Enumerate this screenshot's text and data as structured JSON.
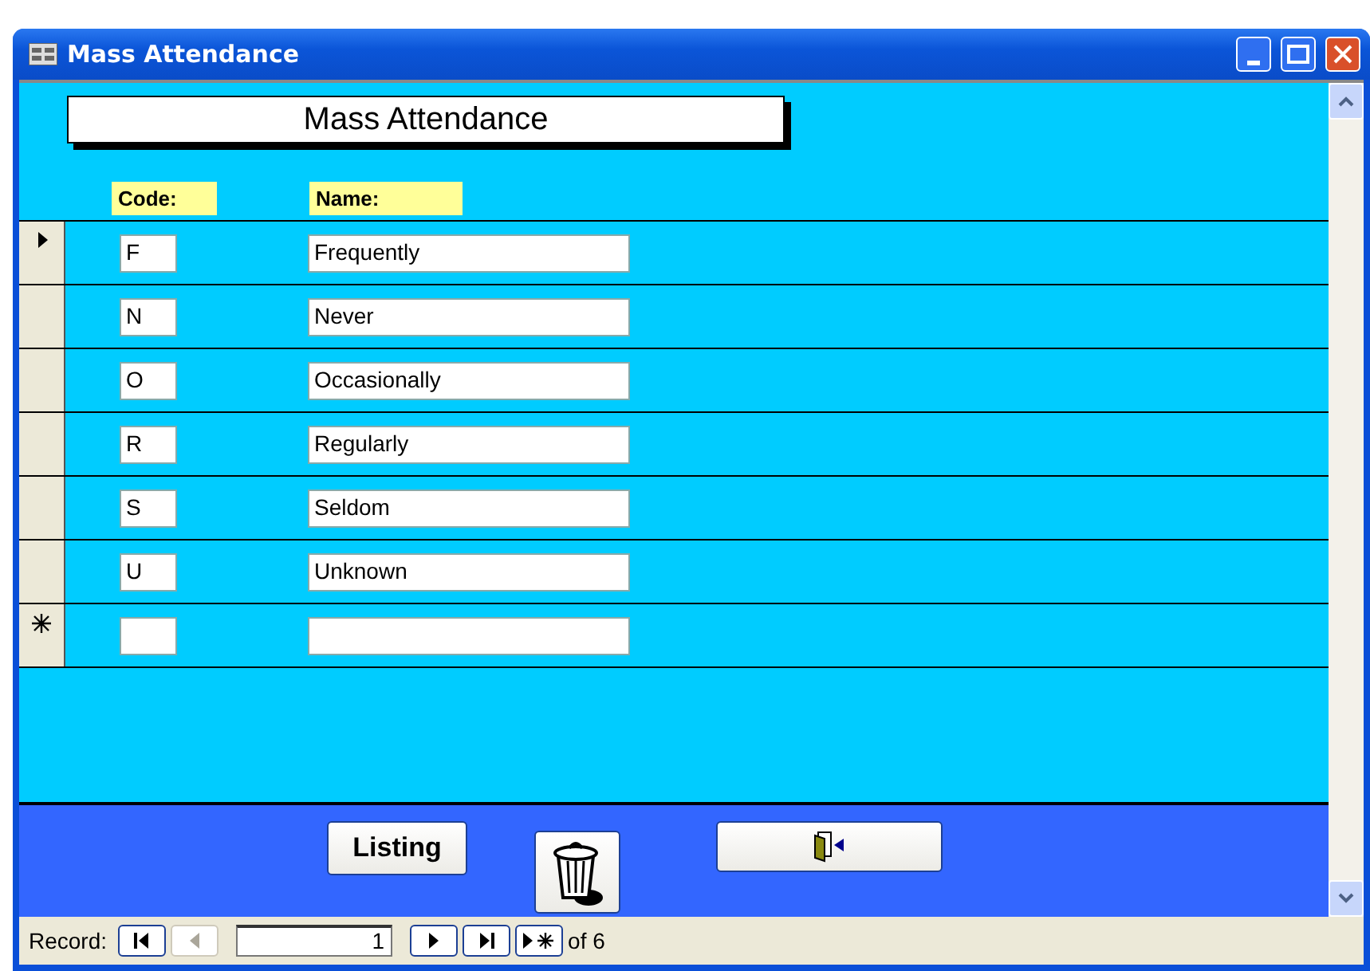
{
  "window": {
    "title": "Mass Attendance"
  },
  "form": {
    "heading": "Mass Attendance",
    "columns": [
      "Code:",
      "Name:"
    ],
    "rows": [
      {
        "kind": "record",
        "code": "F",
        "name": "Frequently",
        "selected": true
      },
      {
        "kind": "record",
        "code": "N",
        "name": "Never",
        "selected": false
      },
      {
        "kind": "record",
        "code": "O",
        "name": "Occasionally",
        "selected": false
      },
      {
        "kind": "record",
        "code": "R",
        "name": "Regularly",
        "selected": false
      },
      {
        "kind": "record",
        "code": "S",
        "name": "Seldom",
        "selected": false
      },
      {
        "kind": "record",
        "code": "U",
        "name": "Unknown",
        "selected": false
      },
      {
        "kind": "new",
        "code": "",
        "name": "",
        "selected": false
      }
    ]
  },
  "footer": {
    "listing_button": "Listing"
  },
  "navigation": {
    "label": "Record:",
    "current": "1",
    "total": "of 6",
    "previous_disabled": true
  }
}
